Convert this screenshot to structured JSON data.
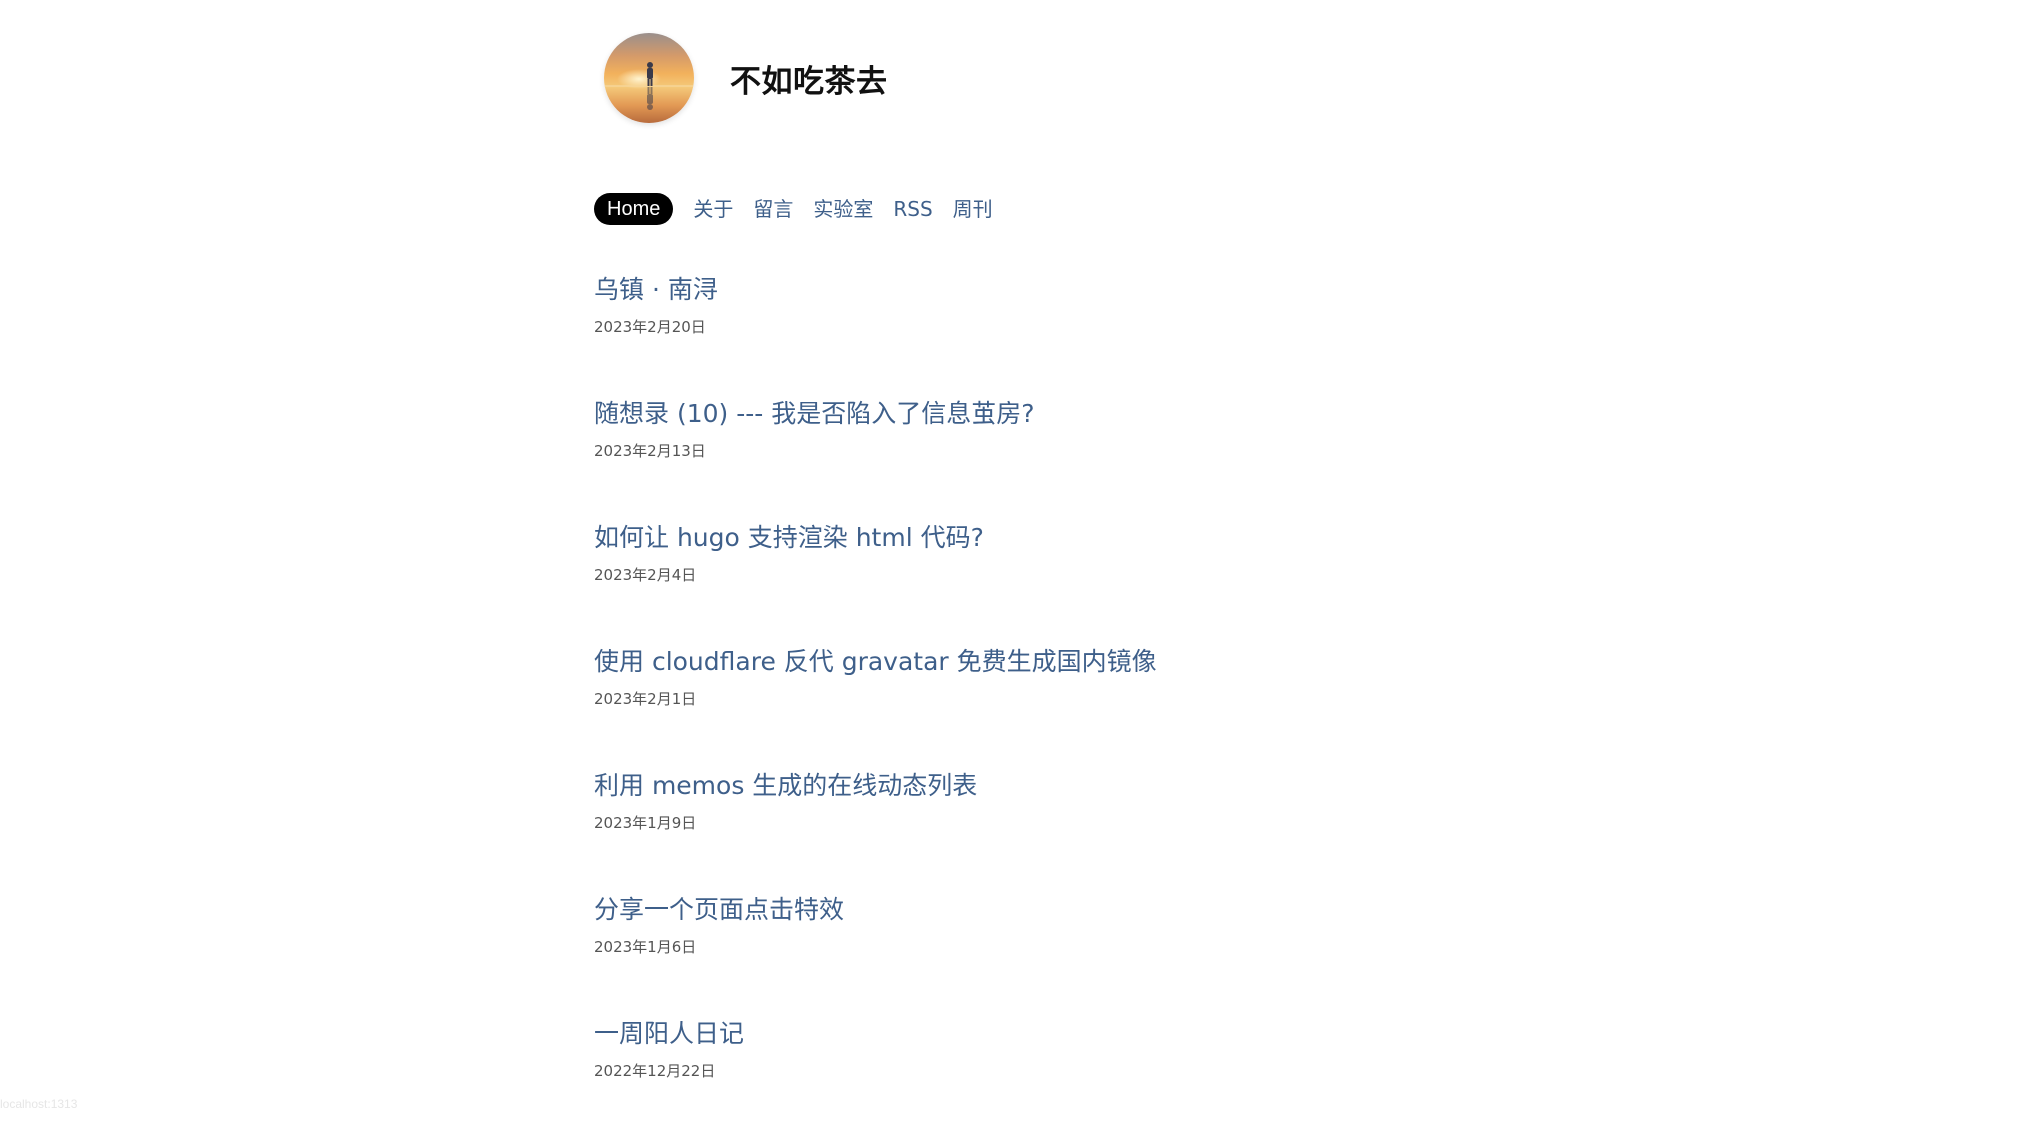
{
  "site": {
    "title": "不如吃茶去"
  },
  "nav": {
    "items": [
      {
        "label": "Home",
        "active": true
      },
      {
        "label": "关于",
        "active": false
      },
      {
        "label": "留言",
        "active": false
      },
      {
        "label": "实验室",
        "active": false
      },
      {
        "label": "RSS",
        "active": false
      },
      {
        "label": "周刊",
        "active": false
      }
    ]
  },
  "posts": [
    {
      "title": "乌镇 · 南浔",
      "date": "2023年2月20日"
    },
    {
      "title": "随想录 (10) --- 我是否陷入了信息茧房?",
      "date": "2023年2月13日"
    },
    {
      "title": "如何让 hugo 支持渲染 html 代码?",
      "date": "2023年2月4日"
    },
    {
      "title": "使用 cloudflare 反代 gravatar 免费生成国内镜像",
      "date": "2023年2月1日"
    },
    {
      "title": "利用 memos 生成的在线动态列表",
      "date": "2023年1月9日"
    },
    {
      "title": "分享一个页面点击特效",
      "date": "2023年1月6日"
    },
    {
      "title": "一周阳人日记",
      "date": "2022年12月22日"
    }
  ],
  "footer": {
    "status_text": "localhost:1313"
  },
  "colors": {
    "link": "#3e5f8a",
    "active_bg": "#000000",
    "date": "#555555"
  },
  "icons": {
    "avatar": "avatar-sunset-photo"
  }
}
